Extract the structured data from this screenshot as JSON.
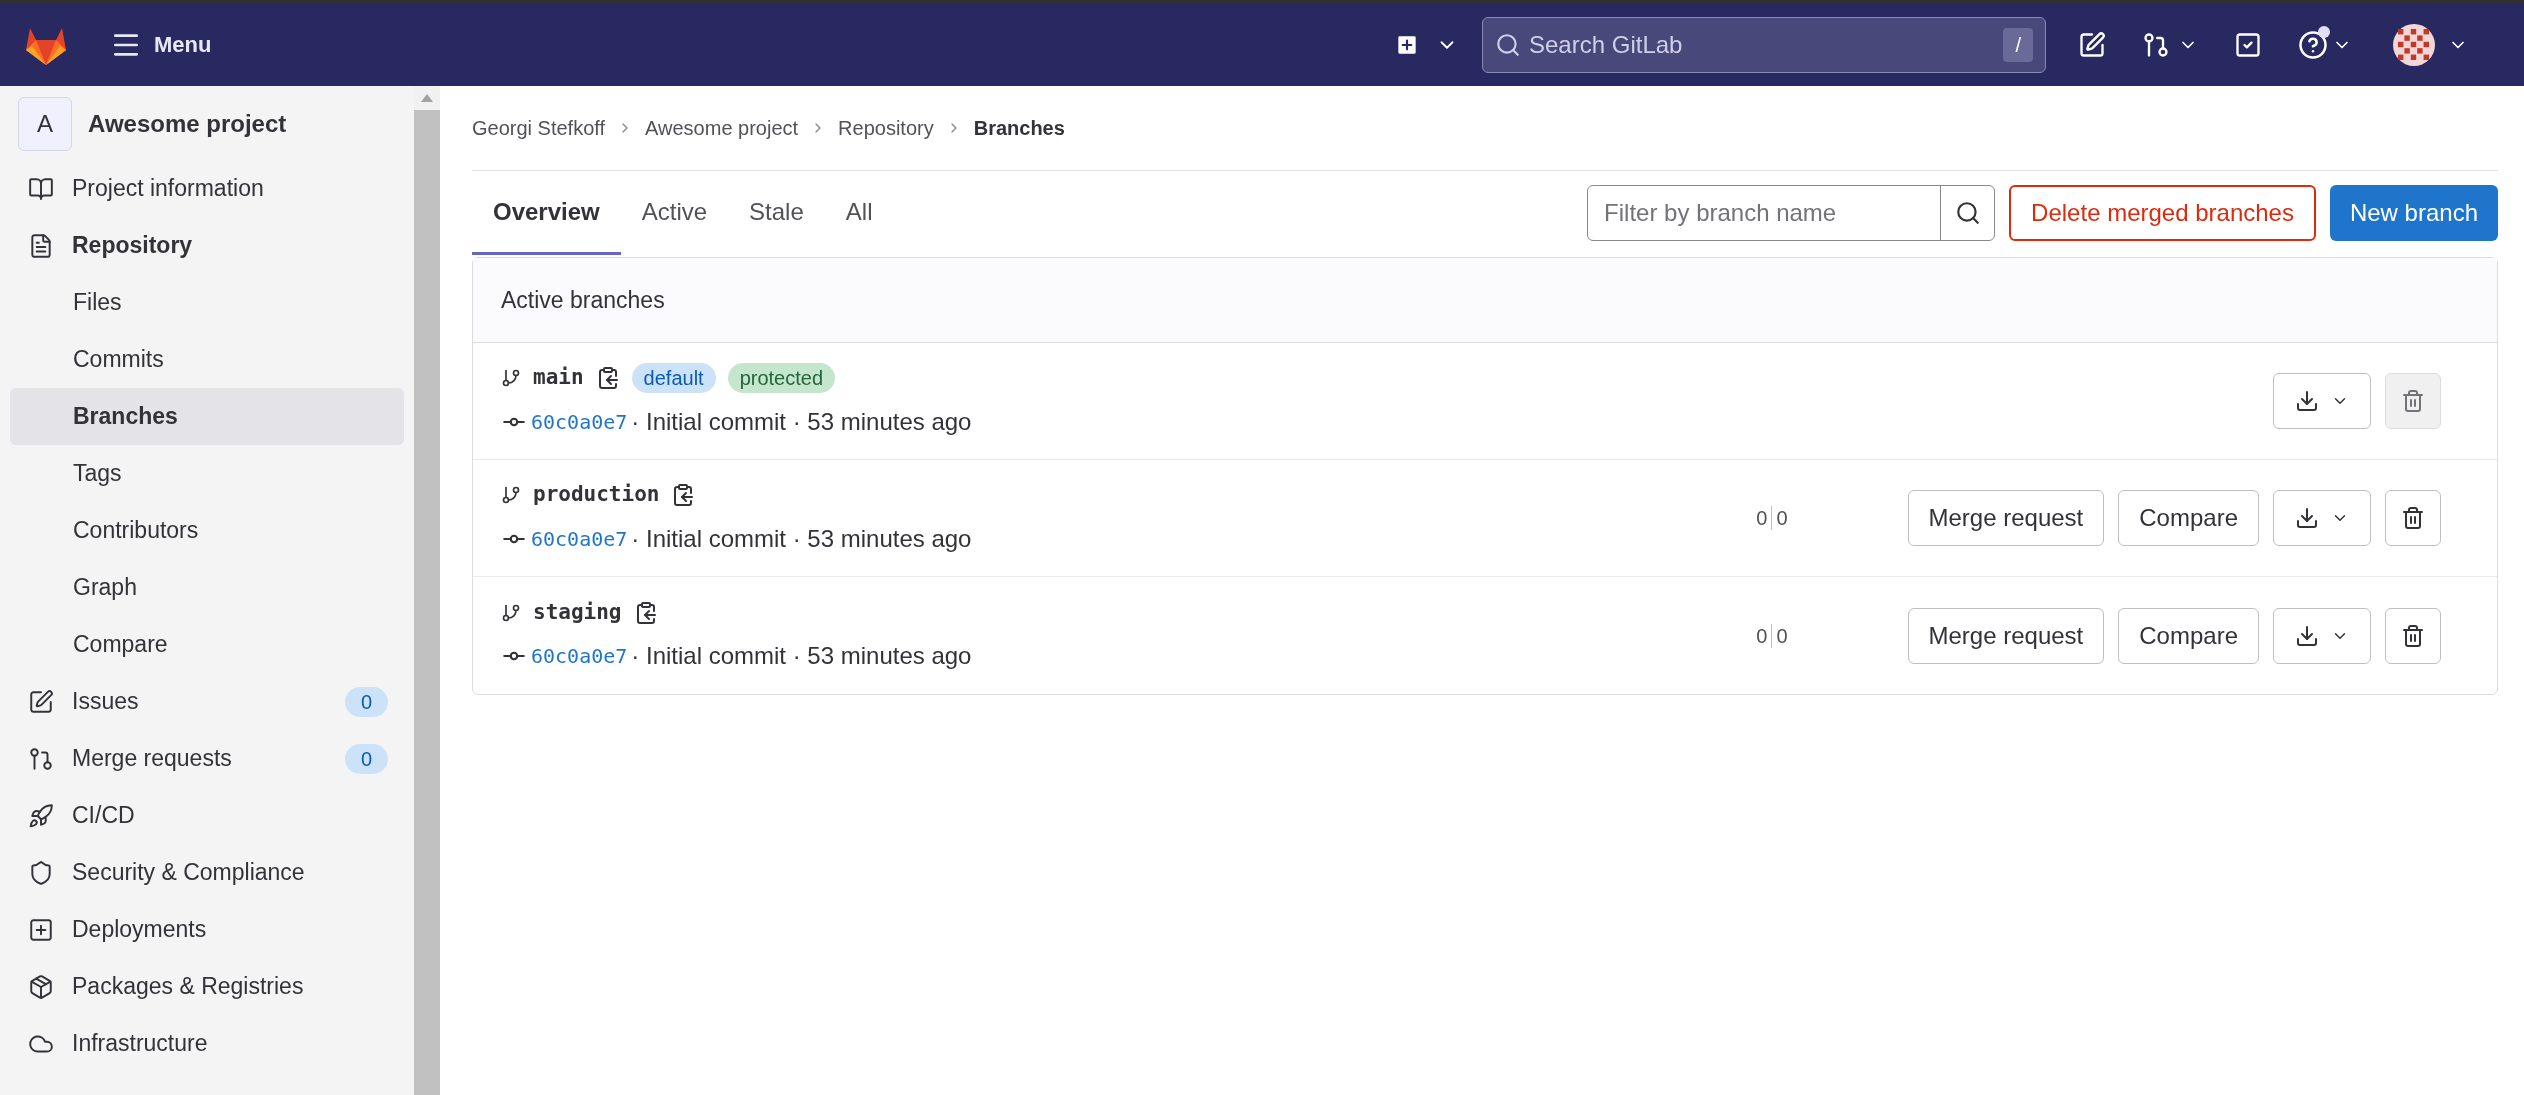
{
  "topbar": {
    "menu_label": "Menu",
    "search": {
      "placeholder": "Search GitLab",
      "shortcut": "/"
    },
    "help_has_notification": true
  },
  "sidebar": {
    "project": {
      "avatar_letter": "A",
      "name": "Awesome project"
    },
    "items": [
      {
        "label": "Project information",
        "selected": false,
        "expanded": false
      },
      {
        "label": "Repository",
        "selected": false,
        "expanded": true,
        "children": [
          {
            "label": "Files",
            "selected": false
          },
          {
            "label": "Commits",
            "selected": false
          },
          {
            "label": "Branches",
            "selected": true
          },
          {
            "label": "Tags",
            "selected": false
          },
          {
            "label": "Contributors",
            "selected": false
          },
          {
            "label": "Graph",
            "selected": false
          },
          {
            "label": "Compare",
            "selected": false
          }
        ]
      },
      {
        "label": "Issues",
        "selected": false,
        "expanded": false,
        "count": "0"
      },
      {
        "label": "Merge requests",
        "selected": false,
        "expanded": false,
        "count": "0"
      },
      {
        "label": "CI/CD",
        "selected": false,
        "expanded": false
      },
      {
        "label": "Security & Compliance",
        "selected": false,
        "expanded": false
      },
      {
        "label": "Deployments",
        "selected": false,
        "expanded": false
      },
      {
        "label": "Packages & Registries",
        "selected": false,
        "expanded": false
      },
      {
        "label": "Infrastructure",
        "selected": false,
        "expanded": false
      }
    ]
  },
  "breadcrumbs": [
    "Georgi Stefkoff",
    "Awesome project",
    "Repository",
    "Branches"
  ],
  "tabs": [
    {
      "label": "Overview",
      "selected": true
    },
    {
      "label": "Active",
      "selected": false
    },
    {
      "label": "Stale",
      "selected": false
    },
    {
      "label": "All",
      "selected": false
    }
  ],
  "filter": {
    "placeholder": "Filter by branch name"
  },
  "buttons": {
    "delete_merged": "Delete merged branches",
    "new_branch": "New branch"
  },
  "section_title": "Active branches",
  "branches": [
    {
      "name": "main",
      "badges": [
        {
          "label": "default",
          "kind": "default"
        },
        {
          "label": "protected",
          "kind": "protected"
        }
      ],
      "sha": "60c0a0e7",
      "message": "· Initial commit · 53 minutes ago",
      "delete_disabled": true
    },
    {
      "name": "production",
      "sha": "60c0a0e7",
      "message": "· Initial commit · 53 minutes ago",
      "behind": "0",
      "ahead": "0",
      "merge_request": "Merge request",
      "compare": "Compare",
      "delete_disabled": false
    },
    {
      "name": "staging",
      "sha": "60c0a0e7",
      "message": "· Initial commit · 53 minutes ago",
      "behind": "0",
      "ahead": "0",
      "merge_request": "Merge request",
      "compare": "Compare",
      "delete_disabled": false
    }
  ]
}
